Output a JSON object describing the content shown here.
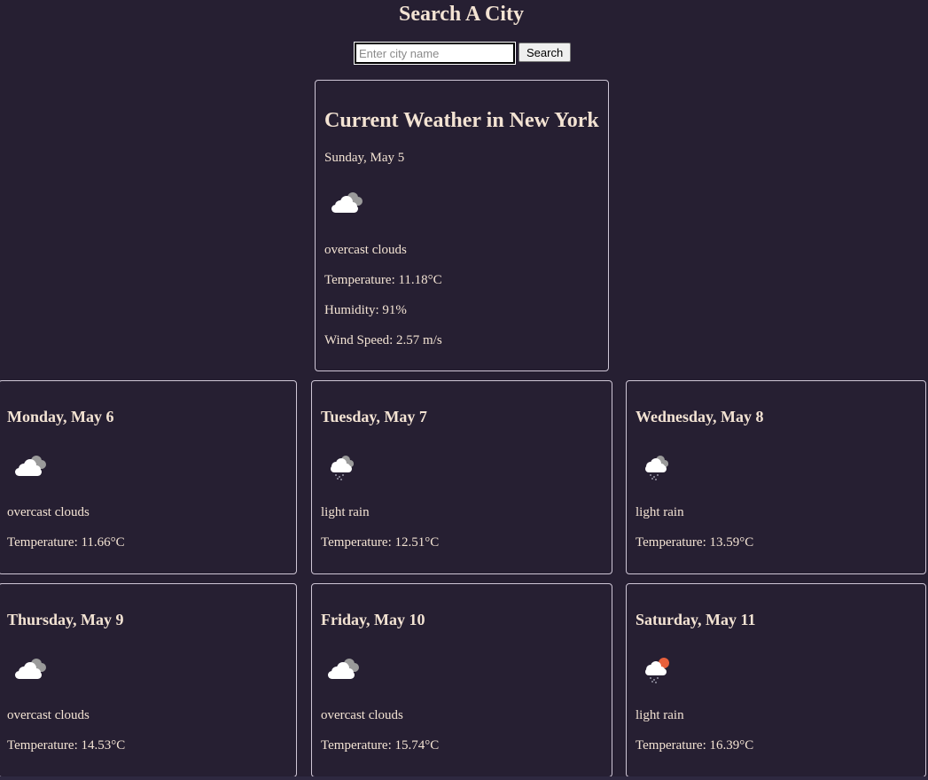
{
  "header": {
    "title": "Search A City"
  },
  "search": {
    "placeholder": "Enter city name",
    "value": "",
    "button_label": "Search"
  },
  "current": {
    "title": "Current Weather in New York",
    "date": "Sunday, May 5",
    "icon": "overcast-clouds-icon",
    "description": "overcast clouds",
    "temperature": "Temperature: 11.18°C",
    "humidity": "Humidity: 91%",
    "wind": "Wind Speed: 2.57 m/s"
  },
  "forecast": [
    {
      "date": "Monday, May 6",
      "icon": "overcast-clouds-icon",
      "description": "overcast clouds",
      "temperature": "Temperature: 11.66°C"
    },
    {
      "date": "Tuesday, May 7",
      "icon": "light-rain-icon",
      "description": "light rain",
      "temperature": "Temperature: 12.51°C"
    },
    {
      "date": "Wednesday, May 8",
      "icon": "light-rain-icon",
      "description": "light rain",
      "temperature": "Temperature: 13.59°C"
    },
    {
      "date": "Thursday, May 9",
      "icon": "overcast-clouds-icon",
      "description": "overcast clouds",
      "temperature": "Temperature: 14.53°C"
    },
    {
      "date": "Friday, May 10",
      "icon": "overcast-clouds-icon",
      "description": "overcast clouds",
      "temperature": "Temperature: 15.74°C"
    },
    {
      "date": "Saturday, May 11",
      "icon": "light-rain-sun-icon",
      "description": "light rain",
      "temperature": "Temperature: 16.39°C"
    }
  ],
  "colors": {
    "background": "#261f32",
    "text": "#f3e3d3",
    "card_border": "#cfc6d6",
    "sun_accent": "#e8603c"
  }
}
